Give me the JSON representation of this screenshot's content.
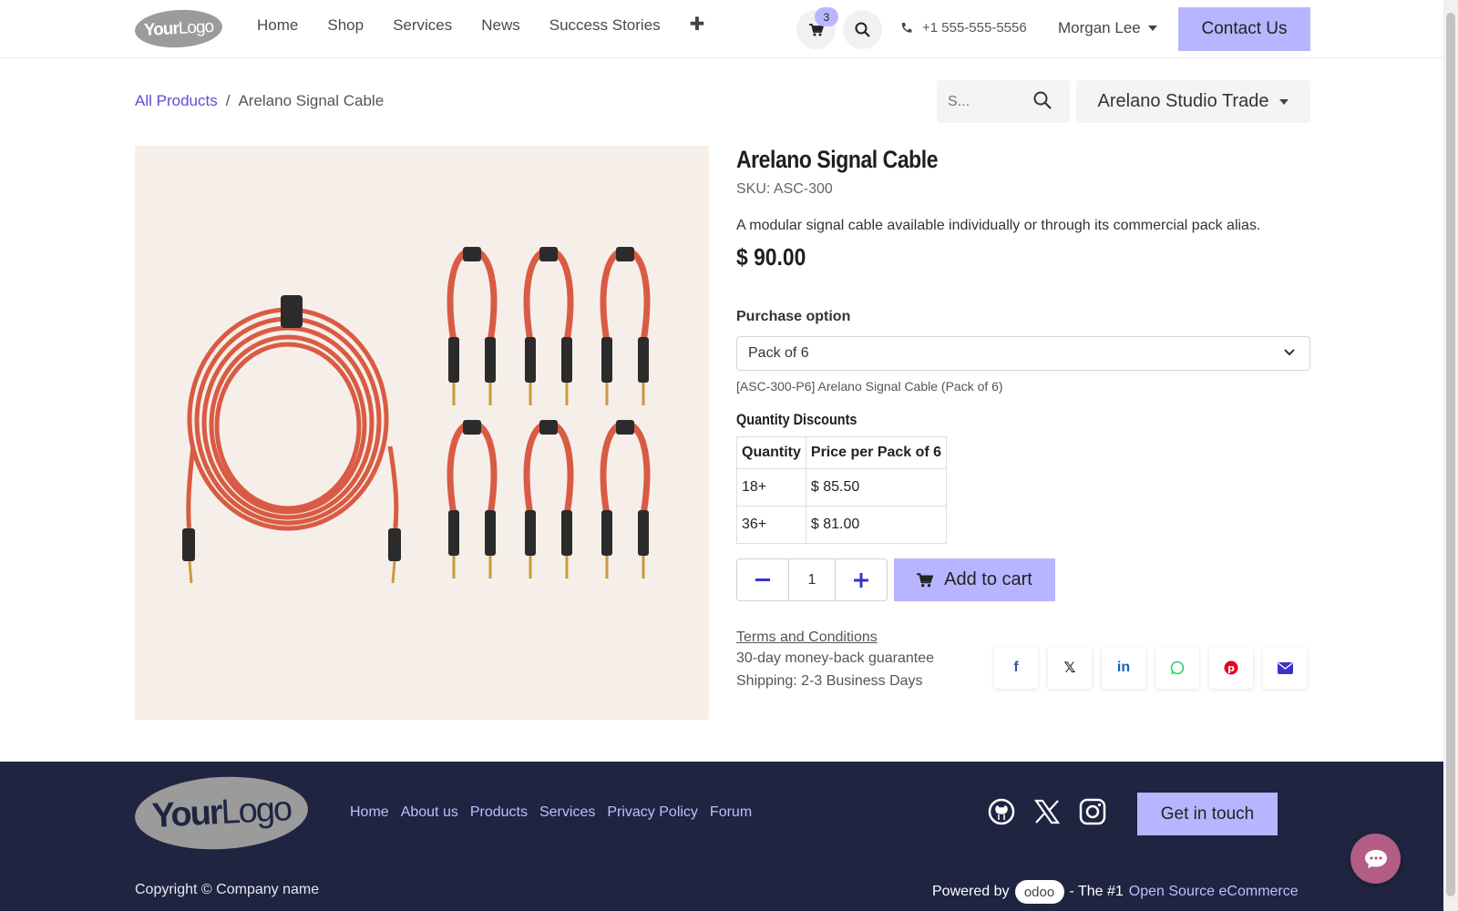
{
  "header": {
    "logo_text_bold": "Your",
    "logo_text": "Logo",
    "nav": [
      "Home",
      "Shop",
      "Services",
      "News",
      "Success Stories"
    ],
    "cart_count": "3",
    "phone": "+1 555-555-5556",
    "user": "Morgan Lee",
    "contact_label": "Contact Us"
  },
  "breadcrumb": {
    "parent": "All Products",
    "sep": "/",
    "current": "Arelano Signal Cable"
  },
  "search": {
    "placeholder": "S..."
  },
  "pricelist": "Arelano Studio Trade",
  "product": {
    "title": "Arelano Signal Cable",
    "sku": "SKU: ASC-300",
    "description": "A modular signal cable available individually or through its commercial pack alias.",
    "price": "$ 90.00",
    "purchase_label": "Purchase option",
    "purchase_selected": "Pack of 6",
    "variant_ref": "[ASC-300-P6] Arelano Signal Cable (Pack of 6)",
    "discount_title": "Quantity Discounts",
    "discount_headers": [
      "Quantity",
      "Price per Pack of 6"
    ],
    "discount_rows": [
      [
        "18+",
        "$ 85.50"
      ],
      [
        "36+",
        "$ 81.00"
      ]
    ],
    "quantity": "1",
    "add_to_cart": "Add to cart",
    "terms": "Terms and Conditions",
    "guarantee": "30-day money-back guarantee",
    "shipping": "Shipping: 2-3 Business Days"
  },
  "share_icons": [
    "facebook-icon",
    "x-icon",
    "linkedin-icon",
    "whatsapp-icon",
    "pinterest-icon",
    "email-icon"
  ],
  "footer": {
    "nav": [
      "Home",
      "About us",
      "Products",
      "Services",
      "Privacy Policy",
      "Forum"
    ],
    "social": [
      "github-icon",
      "x-icon",
      "instagram-icon"
    ],
    "cta": "Get in touch",
    "copyright": "Copyright © Company name",
    "powered_by": "Powered by",
    "odoo": "odoo",
    "the_1": "- The #1",
    "oss": "Open Source eCommerce"
  },
  "colors": {
    "accent": "#b7b5ff",
    "link": "#5a4fd6",
    "footer_bg": "#1f2441",
    "footer_link": "#c0bdff",
    "chat": "#b25d83"
  }
}
